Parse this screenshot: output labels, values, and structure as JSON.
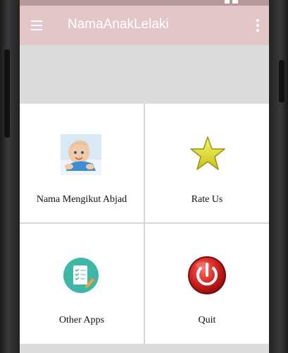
{
  "appbar": {
    "title": "NamaAnakLelaki",
    "menu_icon": "hamburger-menu-icon",
    "overflow_icon": "more-vert-icon",
    "background_color": "#e3c6c7"
  },
  "banner": {
    "background_color": "#dcdcdc"
  },
  "menu": {
    "items": [
      {
        "label": "Nama Mengikut Abjad",
        "icon": "baby-photo-icon"
      },
      {
        "label": "Rate Us",
        "icon": "star-icon"
      },
      {
        "label": "Other Apps",
        "icon": "checklist-icon"
      },
      {
        "label": "Quit",
        "icon": "power-icon"
      }
    ]
  },
  "colors": {
    "star": "#d6d61e",
    "apps_circle": "#3db8a8",
    "power_red": "#d01f1f"
  }
}
